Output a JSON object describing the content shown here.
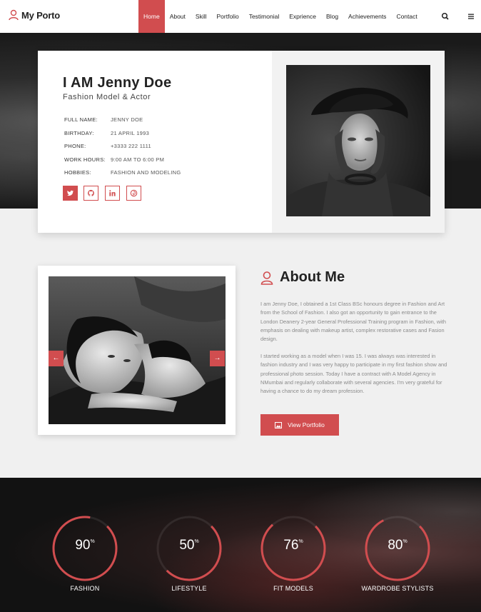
{
  "nav": {
    "logo": "My Porto",
    "items": [
      {
        "label": "Home",
        "active": true
      },
      {
        "label": "About"
      },
      {
        "label": "Skill"
      },
      {
        "label": "Portfolio"
      },
      {
        "label": "Testimonial"
      },
      {
        "label": "Exprience"
      },
      {
        "label": "Blog"
      },
      {
        "label": "Achievements"
      },
      {
        "label": "Contact"
      }
    ],
    "search_icon": "search-icon",
    "menu_icon": "hamburger-icon"
  },
  "profile": {
    "name": "I AM Jenny Doe",
    "role": "Fashion Model & Actor",
    "info": [
      {
        "key": "FULL NAME:",
        "value": "JENNY DOE"
      },
      {
        "key": "BIRTHDAY:",
        "value": "21 APRIL 1993"
      },
      {
        "key": "PHONE:",
        "value": "+3333 222 1111"
      },
      {
        "key": "WORK HOURS:",
        "value": "9:00 AM TO 6:00 PM"
      },
      {
        "key": "HOBBIES:",
        "value": "FASHION AND MODELING"
      }
    ],
    "social": [
      "twitter-icon",
      "github-icon",
      "linkedin-icon",
      "pinterest-icon"
    ]
  },
  "about": {
    "title": "About Me",
    "para1": "I am Jenny Doe, I obtained a 1st Class BSc honours degree in Fashion and Art from the School of Fashion. I also got an opportunity to gain entrance to the London Deanery 2-year General Professional Training program in Fashion, with emphasis on dealing with makeup artist, complex restorative cases and Fasion design.",
    "para2": "I started working as a model when I was 15. I was always was interested in fashion industry and I was very happy to participate in my first fashion show and professional photo session. Today I have a contract with A Model Agency in NMumbai and regularly collaborate with several agencies. I'm very grateful for having a chance to do my dream profession.",
    "button": "View Portfolio",
    "prev": "←",
    "next": "→"
  },
  "skills": [
    {
      "value": "90",
      "unit": "%",
      "label": "FASHION",
      "percent": 90
    },
    {
      "value": "50",
      "unit": "%",
      "label": "LIFESTYLE",
      "percent": 50
    },
    {
      "value": "76",
      "unit": "%",
      "label": "FIT MODELS",
      "percent": 76
    },
    {
      "value": "80",
      "unit": "%",
      "label": "WARDROBE STYLISTS",
      "percent": 80
    }
  ],
  "colors": {
    "accent": "#d14d4f"
  }
}
